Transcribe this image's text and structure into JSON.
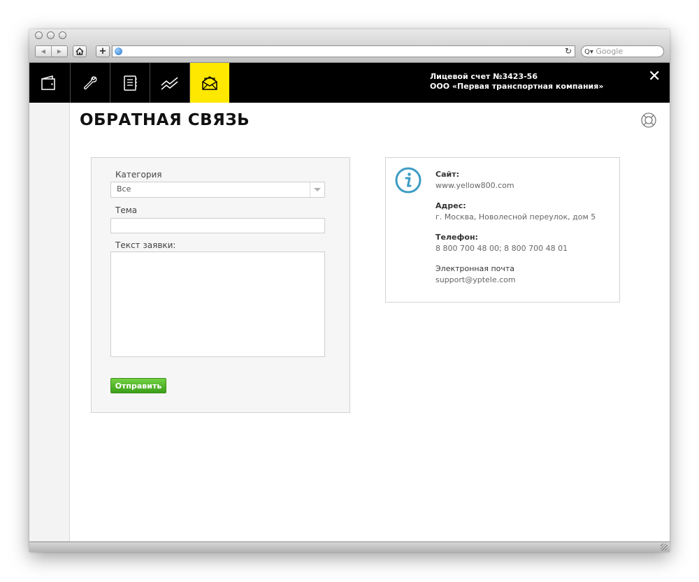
{
  "browser": {
    "search_placeholder": "Google",
    "url": ""
  },
  "header": {
    "nav": [
      {
        "icon": "wallet-icon"
      },
      {
        "icon": "wrench-icon"
      },
      {
        "icon": "notebook-icon"
      },
      {
        "icon": "chart-icon"
      },
      {
        "icon": "envelope-icon",
        "active": true
      }
    ],
    "account_line1": "Лицевой счет №3423-56",
    "account_line2": "ООО «Первая транспортная компания»",
    "close_symbol": "✕",
    "active_color": "#ffe800"
  },
  "page": {
    "title": "ОБРАТНАЯ СВЯЗЬ",
    "help_icon": "lifebuoy-icon"
  },
  "form": {
    "category_label": "Категория",
    "category_value": "Все",
    "subject_label": "Тема",
    "subject_value": "",
    "text_label": "Текст заявки:",
    "text_value": "",
    "submit_label": "Отправить",
    "submit_color": "#4aa81f"
  },
  "contacts": {
    "icon": "info-icon",
    "site_label": "Сайт:",
    "site_value": "www.yellow800.com",
    "address_label": "Адрес:",
    "address_value": "г. Москва, Новолесной переулок, дом 5",
    "phone_label": "Телефон:",
    "phone_value": "8 800 700 48 00; 8 800 700 48 01",
    "email_label": "Электронная почта",
    "email_value": "support@yptele.com",
    "accent_color": "#3c9cc4"
  }
}
